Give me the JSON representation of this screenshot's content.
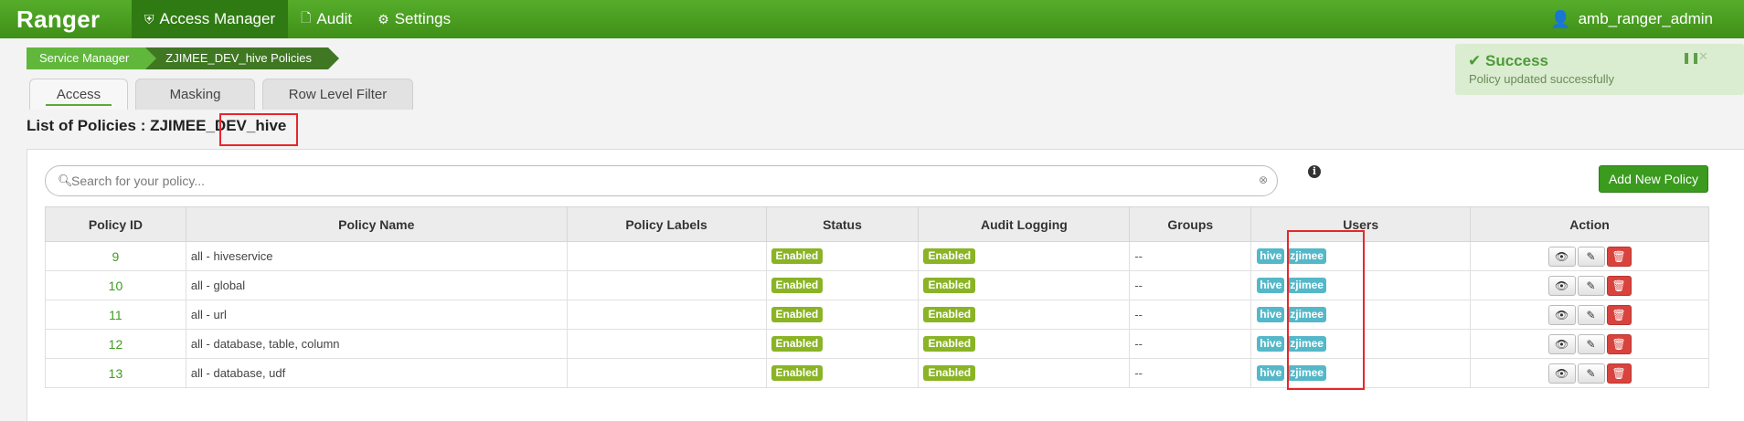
{
  "navbar": {
    "brand": "Ranger",
    "items": [
      {
        "label": "Access Manager",
        "icon": "shield-icon",
        "active": true
      },
      {
        "label": "Audit",
        "icon": "document-icon",
        "active": false
      },
      {
        "label": "Settings",
        "icon": "gear-icon",
        "active": false
      }
    ],
    "user": "amb_ranger_admin"
  },
  "breadcrumb": [
    "Service Manager",
    "ZJIMEE_DEV_hive Policies"
  ],
  "tabs": [
    "Access",
    "Masking",
    "Row Level Filter"
  ],
  "page_title": "List of Policies : ZJIMEE_DEV_hive",
  "alert": {
    "title": "Success",
    "message": "Policy updated successfully"
  },
  "search": {
    "placeholder": "Search for your policy..."
  },
  "add_button": "Add New Policy",
  "table": {
    "headers": [
      "Policy ID",
      "Policy Name",
      "Policy Labels",
      "Status",
      "Audit Logging",
      "Groups",
      "Users",
      "Action"
    ],
    "rows": [
      {
        "id": "9",
        "name": "all - hiveservice",
        "labels": "",
        "status": "Enabled",
        "audit": "Enabled",
        "groups": "--",
        "users": [
          "hive",
          "zjimee"
        ]
      },
      {
        "id": "10",
        "name": "all - global",
        "labels": "",
        "status": "Enabled",
        "audit": "Enabled",
        "groups": "--",
        "users": [
          "hive",
          "zjimee"
        ]
      },
      {
        "id": "11",
        "name": "all - url",
        "labels": "",
        "status": "Enabled",
        "audit": "Enabled",
        "groups": "--",
        "users": [
          "hive",
          "zjimee"
        ]
      },
      {
        "id": "12",
        "name": "all - database, table, column",
        "labels": "",
        "status": "Enabled",
        "audit": "Enabled",
        "groups": "--",
        "users": [
          "hive",
          "zjimee"
        ]
      },
      {
        "id": "13",
        "name": "all - database, udf",
        "labels": "",
        "status": "Enabled",
        "audit": "Enabled",
        "groups": "--",
        "users": [
          "hive",
          "zjimee"
        ]
      }
    ]
  },
  "colors": {
    "brand_green": "#4a9e22",
    "enabled_badge": "#8ab425",
    "user_badge": "#55b8c9",
    "delete": "#d9433e",
    "highlight_box": "#e8262a"
  }
}
